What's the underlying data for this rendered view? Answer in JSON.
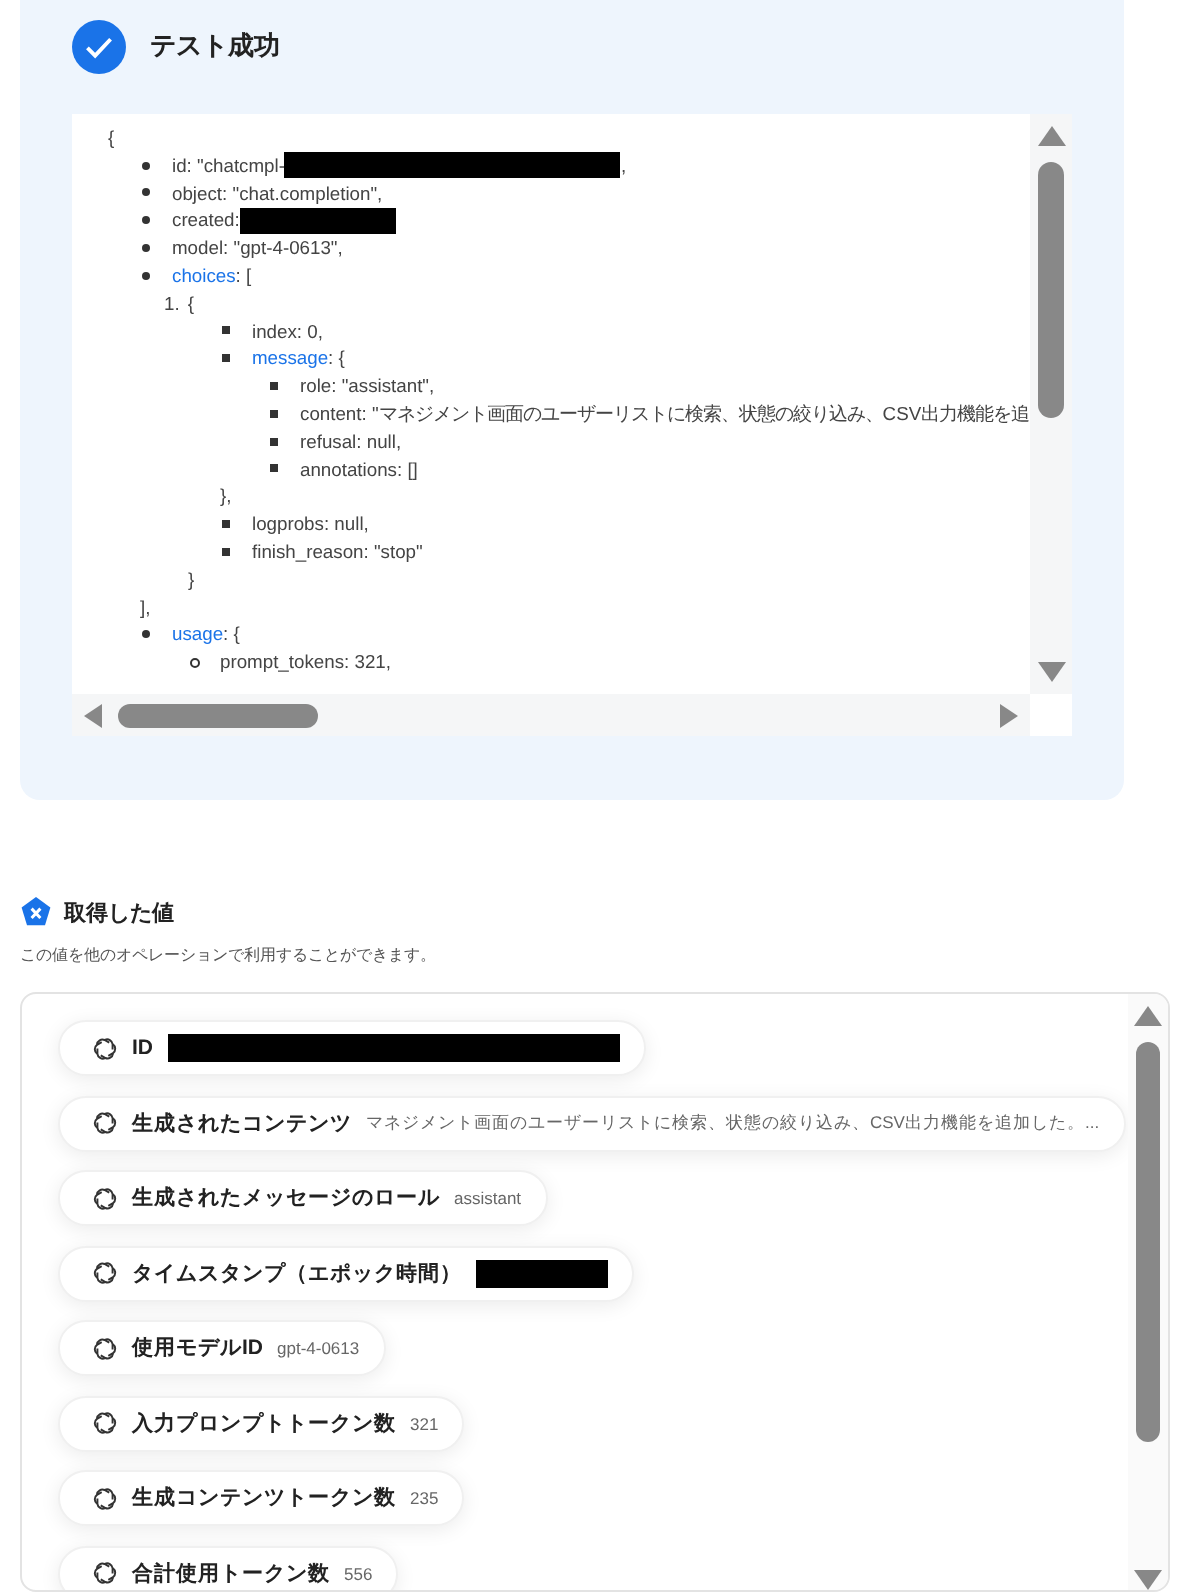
{
  "result": {
    "title": "テスト成功",
    "code": {
      "open": "{",
      "items": [
        {
          "key": "id",
          "value": ": \"chatcmpl-",
          "redacted": true,
          "tail": ","
        },
        {
          "key": "object",
          "value": ": \"chat.completion\","
        },
        {
          "key": "created",
          "value": ":",
          "redacted": true
        },
        {
          "key": "model",
          "value": ": \"gpt-4-0613\","
        },
        {
          "key": "choices",
          "link": true,
          "value": ": [",
          "children": [
            {
              "marker": "1.",
              "value": "{",
              "children": [
                {
                  "key": "index",
                  "value": ": 0,"
                },
                {
                  "key": "message",
                  "link": true,
                  "value": ": {",
                  "children": [
                    {
                      "key": "role",
                      "value": ": \"assistant\","
                    },
                    {
                      "key": "content",
                      "value": ": \"マネジメント画面のユーザーリストに検索、状態の絞り込み、CSV出力機能を追"
                    },
                    {
                      "key": "refusal",
                      "value": ": null,"
                    },
                    {
                      "key": "annotations",
                      "value": ": []"
                    }
                  ],
                  "close": "},"
                },
                {
                  "key": "logprobs",
                  "value": ": null,"
                },
                {
                  "key": "finish_reason",
                  "value": ": \"stop\""
                }
              ],
              "close": "}"
            }
          ],
          "close": "],"
        },
        {
          "key": "usage",
          "link": true,
          "value": ": {",
          "children": [
            {
              "key": "prompt_tokens",
              "value": ": 321,"
            }
          ]
        }
      ]
    }
  },
  "values": {
    "title": "取得した値",
    "caption": "この値を他のオペレーションで利用することができます。",
    "items": [
      {
        "label": "ID",
        "redacted": true
      },
      {
        "label": "生成されたコンテンツ",
        "value": "マネジメント画面のユーザーリストに検索、状態の絞り込み、CSV出力機能を追加した。..."
      },
      {
        "label": "生成されたメッセージのロール",
        "value": "assistant"
      },
      {
        "label": "タイムスタンプ（エポック時間）",
        "redacted": true
      },
      {
        "label": "使用モデルID",
        "value": "gpt-4-0613"
      },
      {
        "label": "入力プロンプトトークン数",
        "value": "321"
      },
      {
        "label": "生成コンテンツトークン数",
        "value": "235"
      },
      {
        "label": "合計使用トークン数",
        "value": "556"
      }
    ]
  }
}
